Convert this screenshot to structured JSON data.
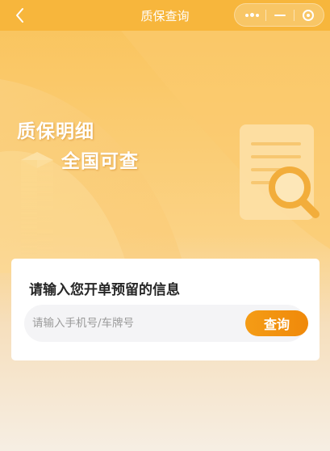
{
  "navbar": {
    "title": "质保查询",
    "icons": {
      "back": "chevron-left-icon",
      "more": "more-dots-icon",
      "minimize": "minimize-icon",
      "close": "close-target-icon"
    }
  },
  "banner": {
    "line1": "质保明细",
    "line2": "全国可查",
    "illustration": "document-magnifier-icon"
  },
  "search_card": {
    "title": "请输入您开单预留的信息",
    "input_placeholder": "请输入手机号/车牌号",
    "input_value": "",
    "button_label": "查询"
  },
  "colors": {
    "primary_orange": "#f7b63c",
    "button_orange": "#f2920f",
    "title_text": "#262626"
  }
}
